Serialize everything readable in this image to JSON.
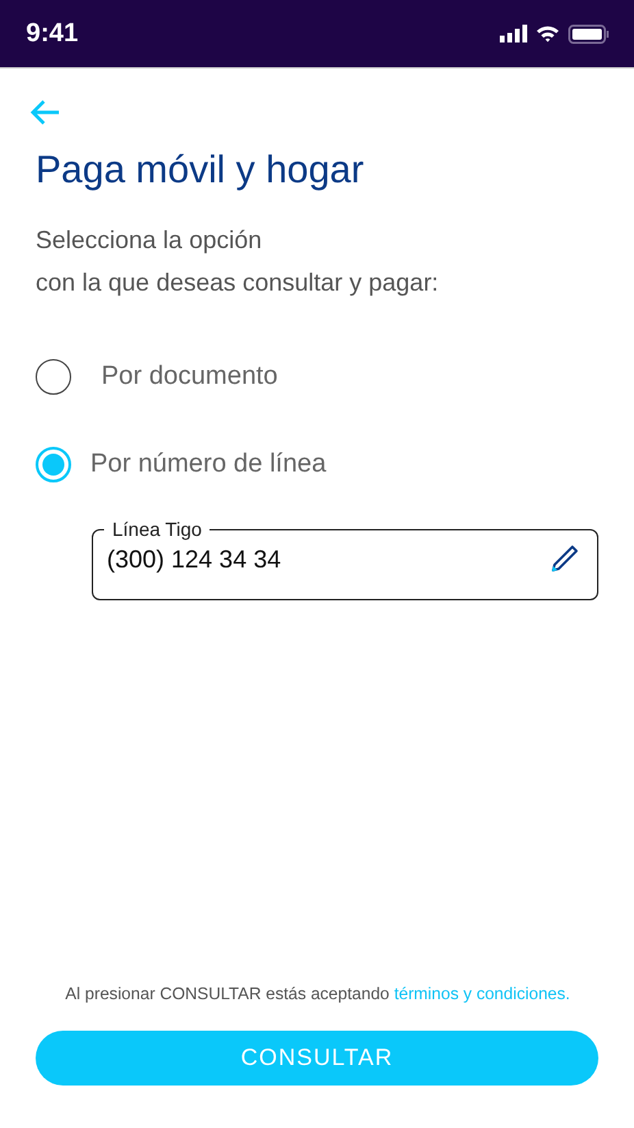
{
  "status_bar": {
    "time": "9:41"
  },
  "title": "Paga móvil y hogar",
  "subtitle": [
    "Selecciona la opción",
    "con la que deseas consultar y pagar:"
  ],
  "options": [
    {
      "label": "Por documento",
      "selected": false
    },
    {
      "label": "Por número de línea",
      "selected": true
    }
  ],
  "line_field": {
    "label": "Línea Tigo",
    "value": "(300) 124 34 34"
  },
  "terms": {
    "text": "Al presionar CONSULTAR estás aceptando",
    "link": "términos y condiciones."
  },
  "button": "CONSULTAR"
}
